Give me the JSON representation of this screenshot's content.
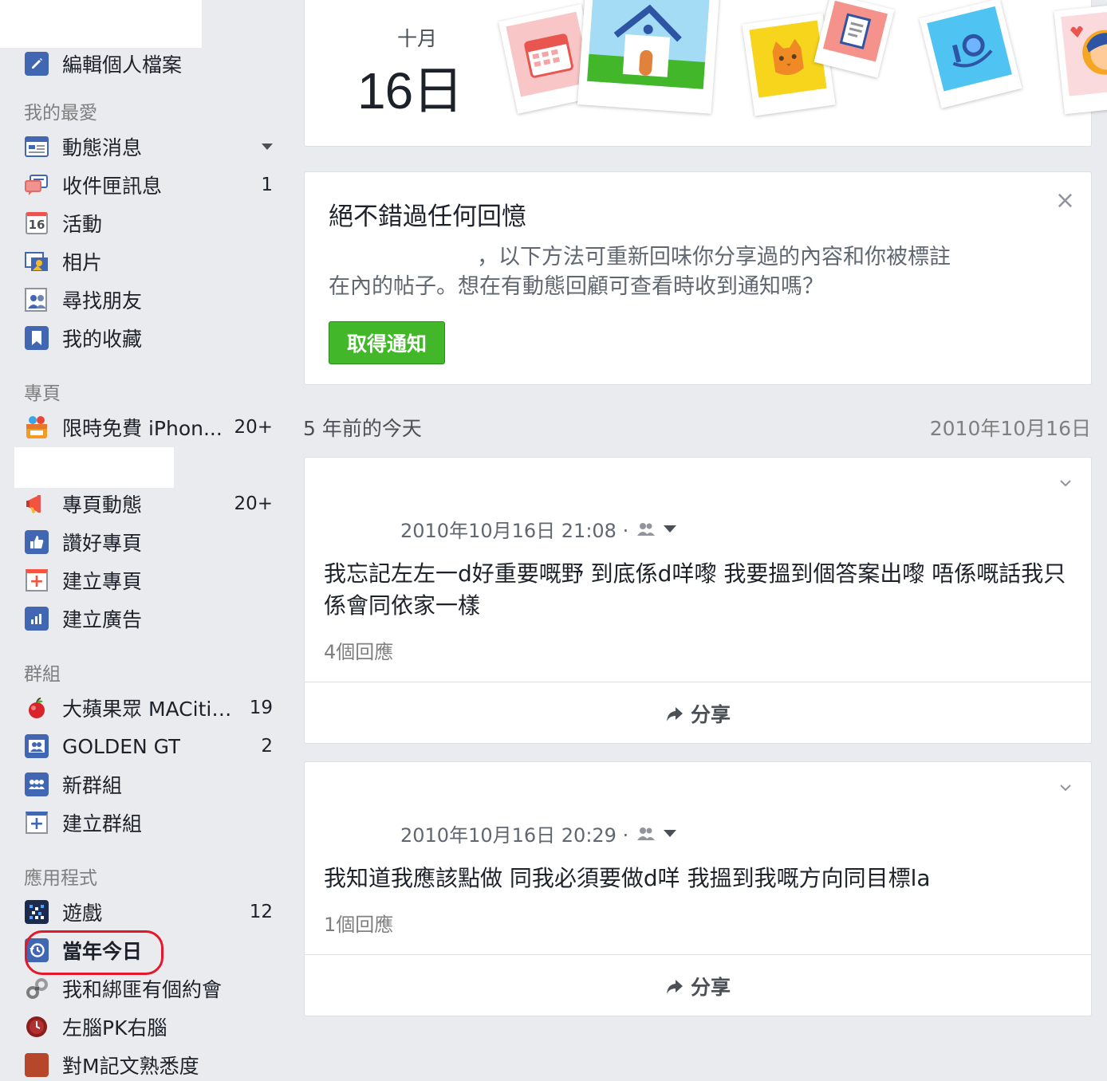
{
  "sidebar": {
    "edit_profile": "編輯個人檔案",
    "favorites_header": "我的最愛",
    "favorites": [
      {
        "label": "動態消息",
        "icon": "news-feed-icon",
        "count": ""
      },
      {
        "label": "收件匣訊息",
        "icon": "messages-icon",
        "count": "1"
      },
      {
        "label": "活動",
        "icon": "events-calendar-icon",
        "count": "",
        "icon_text": "16"
      },
      {
        "label": "相片",
        "icon": "photos-icon",
        "count": ""
      },
      {
        "label": "尋找朋友",
        "icon": "find-friends-icon",
        "count": ""
      },
      {
        "label": "我的收藏",
        "icon": "saved-bookmark-icon",
        "count": ""
      }
    ],
    "pages_header": "專頁",
    "pages": [
      {
        "label": "限時免費 iPhon...",
        "icon": "app-gift-icon",
        "count": "20+"
      },
      {
        "label": "專頁動態",
        "icon": "megaphone-icon",
        "count": "20+"
      },
      {
        "label": "讚好專頁",
        "icon": "thumbs-up-icon",
        "count": ""
      },
      {
        "label": "建立專頁",
        "icon": "create-page-icon",
        "count": ""
      },
      {
        "label": "建立廣告",
        "icon": "create-ad-icon",
        "count": ""
      }
    ],
    "groups_header": "群組",
    "groups": [
      {
        "label": "大蘋果眾 MACitiz...",
        "icon": "apple-icon",
        "count": "19"
      },
      {
        "label": "GOLDEN GT",
        "icon": "group-icon",
        "count": "2"
      },
      {
        "label": "新群組",
        "icon": "new-group-icon",
        "count": ""
      },
      {
        "label": "建立群組",
        "icon": "create-group-icon",
        "count": ""
      }
    ],
    "apps_header": "應用程式",
    "apps": [
      {
        "label": "遊戲",
        "icon": "games-icon",
        "count": "12"
      },
      {
        "label": "當年今日",
        "icon": "on-this-day-icon",
        "count": ""
      },
      {
        "label": "我和綁匪有個約會",
        "icon": "handcuffs-icon",
        "count": ""
      },
      {
        "label": "左腦PK右腦",
        "icon": "brain-icon",
        "count": ""
      },
      {
        "label": "對M記文熟悉度",
        "icon": "app-icon",
        "count": ""
      }
    ]
  },
  "date_card": {
    "month": "十月",
    "day": "16日"
  },
  "memories": {
    "title": "絕不錯過任何回憶",
    "body_line1": "，以下方法可重新回味你分享過的內容和你被標註",
    "body_line2": "在內的帖子。想在有動態回顧可查看時收到通知嗎？",
    "button": "取得通知",
    "close": "×"
  },
  "section": {
    "label": "5 年前的今天",
    "date": "2010年10月16日"
  },
  "posts": [
    {
      "timestamp": "2010年10月16日 21:08 ·",
      "text": "我忘記左左一d好重要嘅野 到底係d咩嚟 我要搵到個答案出嚟 唔係嘅話我只係會同依家一樣",
      "comments": "4個回應",
      "share": "分享"
    },
    {
      "timestamp": "2010年10月16日 20:29 ·",
      "text": "我知道我應該點做 同我必須要做d咩 我搵到我嘅方向同目標la",
      "comments": "1個回應",
      "share": "分享"
    }
  ],
  "colors": {
    "accent_blue": "#4267b2",
    "button_green": "#42b72a",
    "highlight_red": "#e3192b"
  }
}
